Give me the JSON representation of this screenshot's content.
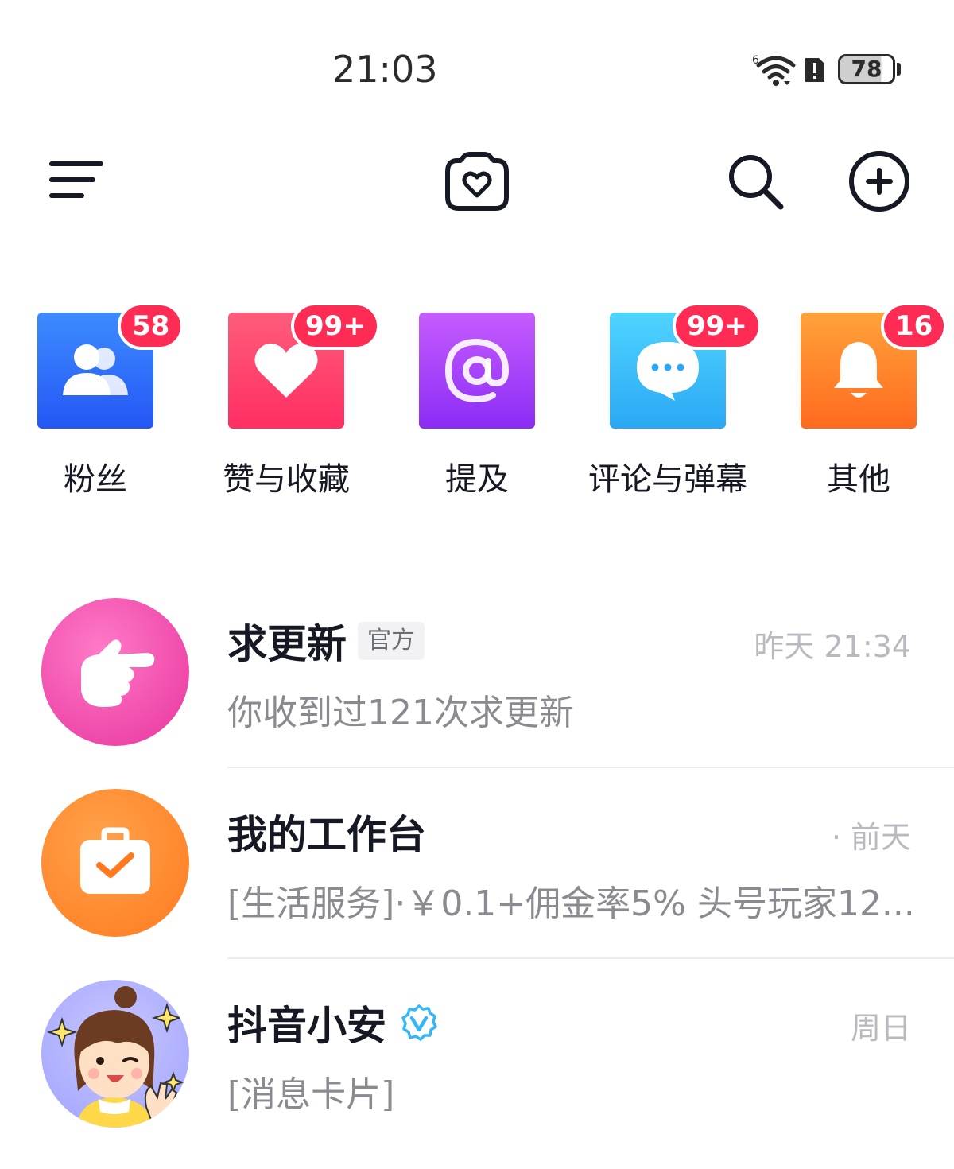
{
  "status_bar": {
    "time": "21:03",
    "battery": "78",
    "wifi_icon": "wifi-6-icon",
    "alert_icon": "sim-alert-icon"
  },
  "nav": {
    "menu_icon": "hamburger-menu-icon",
    "camera_icon": "heart-camera-icon",
    "search_icon": "search-icon",
    "add_icon": "add-circle-icon"
  },
  "categories": [
    {
      "label": "粉丝",
      "badge": "58",
      "icon": "people-icon",
      "color_top": "#3d8bff",
      "color_bottom": "#2457f5"
    },
    {
      "label": "赞与收藏",
      "badge": "99+",
      "icon": "heart-icon",
      "color_top": "#ff5c7a",
      "color_bottom": "#ff2e63"
    },
    {
      "label": "提及",
      "badge": "",
      "icon": "at-icon",
      "color_top": "#c65cff",
      "color_bottom": "#8a2cf5"
    },
    {
      "label": "评论与弹幕",
      "badge": "99+",
      "icon": "comment-bubble-icon",
      "color_top": "#4fd4ff",
      "color_bottom": "#2ba8f5"
    },
    {
      "label": "其他",
      "badge": "16",
      "icon": "bell-icon",
      "color_top": "#ffa23a",
      "color_bottom": "#ff6a1f"
    }
  ],
  "messages": [
    {
      "title": "求更新",
      "tag": "官方",
      "time": "昨天 21:34",
      "preview": "你收到过121次求更新",
      "avatar_icon": "pointing-hand-icon"
    },
    {
      "title": "我的工作台",
      "time": "· 前天",
      "preview": "[生活服务]·￥0.1+佣金率5% 头号玩家12...",
      "avatar_icon": "briefcase-check-icon"
    },
    {
      "title": "抖音小安",
      "verified_icon": "verified-badge-icon",
      "time": "周日",
      "preview": "[消息卡片]",
      "avatar_icon": "cartoon-girl-avatar"
    }
  ]
}
